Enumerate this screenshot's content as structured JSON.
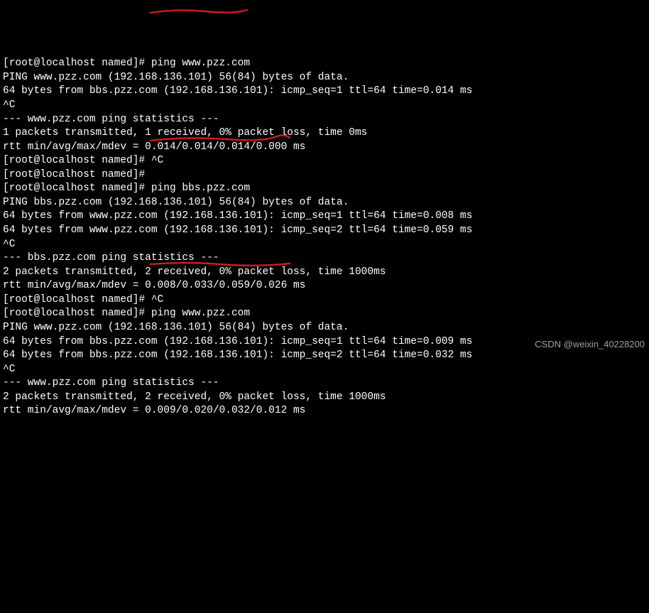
{
  "prompt_user": "root",
  "prompt_host": "localhost",
  "prompt_dir": "named",
  "prompt_symbol": "#",
  "watermark": "CSDN @weixin_40228200",
  "annotations": {
    "underline1_color": "#d01c1c",
    "underline2_color": "#d01c1c",
    "underline3_color": "#d01c1c"
  },
  "lines": [
    "[root@localhost named]# ping www.pzz.com",
    "PING www.pzz.com (192.168.136.101) 56(84) bytes of data.",
    "64 bytes from bbs.pzz.com (192.168.136.101): icmp_seq=1 ttl=64 time=0.014 ms",
    "^C",
    "--- www.pzz.com ping statistics ---",
    "1 packets transmitted, 1 received, 0% packet loss, time 0ms",
    "rtt min/avg/max/mdev = 0.014/0.014/0.014/0.000 ms",
    "[root@localhost named]# ^C",
    "[root@localhost named]#",
    "[root@localhost named]# ping bbs.pzz.com",
    "PING bbs.pzz.com (192.168.136.101) 56(84) bytes of data.",
    "64 bytes from www.pzz.com (192.168.136.101): icmp_seq=1 ttl=64 time=0.008 ms",
    "64 bytes from www.pzz.com (192.168.136.101): icmp_seq=2 ttl=64 time=0.059 ms",
    "^C",
    "--- bbs.pzz.com ping statistics ---",
    "2 packets transmitted, 2 received, 0% packet loss, time 1000ms",
    "rtt min/avg/max/mdev = 0.008/0.033/0.059/0.026 ms",
    "[root@localhost named]# ^C",
    "[root@localhost named]# ping www.pzz.com",
    "PING www.pzz.com (192.168.136.101) 56(84) bytes of data.",
    "64 bytes from bbs.pzz.com (192.168.136.101): icmp_seq=1 ttl=64 time=0.009 ms",
    "64 bytes from bbs.pzz.com (192.168.136.101): icmp_seq=2 ttl=64 time=0.032 ms",
    "^C",
    "--- www.pzz.com ping statistics ---",
    "2 packets transmitted, 2 received, 0% packet loss, time 1000ms",
    "rtt min/avg/max/mdev = 0.009/0.020/0.032/0.012 ms"
  ]
}
